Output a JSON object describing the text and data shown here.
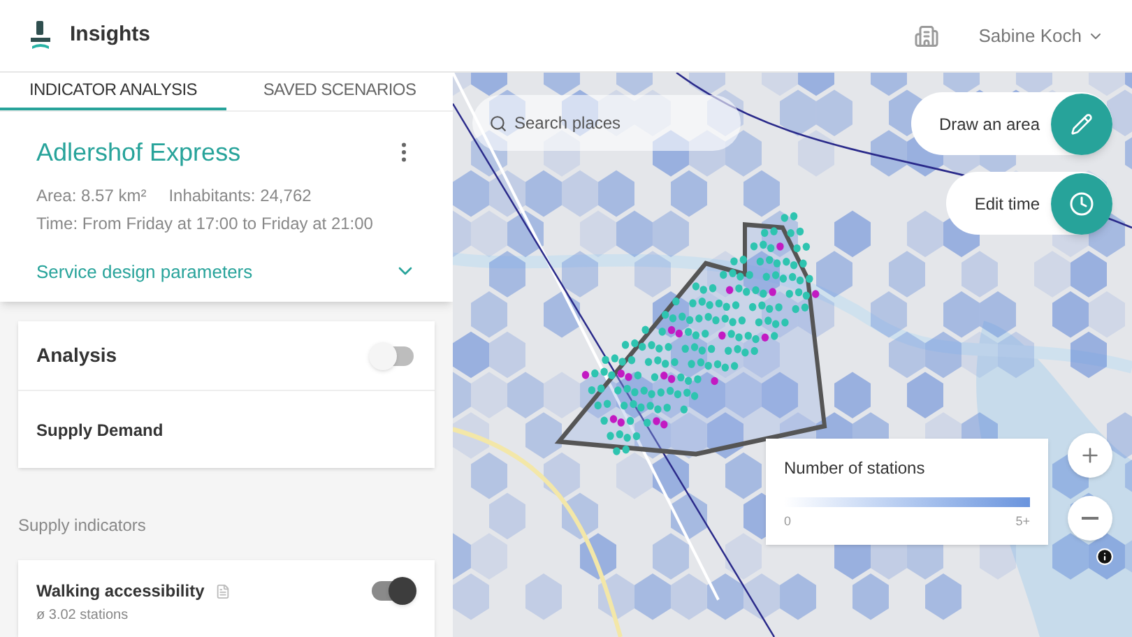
{
  "app": {
    "title": "Insights",
    "user": "Sabine Koch"
  },
  "tabs": [
    {
      "label": "INDICATOR ANALYSIS",
      "selected": true
    },
    {
      "label": "SAVED SCENARIOS",
      "selected": false
    }
  ],
  "scenario": {
    "name": "Adlershof Express",
    "area": "Area: 8.57 km²",
    "inhabitants": "Inhabitants: 24,762",
    "time": "Time: From Friday at 17:00 to Friday at 21:00",
    "parameters_link": "Service design parameters",
    "parameters_expanded": false
  },
  "analysis": {
    "title": "Analysis",
    "on": false,
    "mode": "Supply Demand"
  },
  "supply_indicators": {
    "heading": "Supply indicators",
    "items": [
      {
        "name": "Walking accessibility",
        "value": "ø 3.02 stations",
        "on": true
      }
    ]
  },
  "map": {
    "search_placeholder": "Search places",
    "actions": [
      {
        "label": "Draw an area",
        "kind": "draw"
      },
      {
        "label": "Edit time",
        "kind": "time"
      }
    ],
    "legend": {
      "title": "Number of stations",
      "min": "0",
      "max": "5+"
    }
  }
}
